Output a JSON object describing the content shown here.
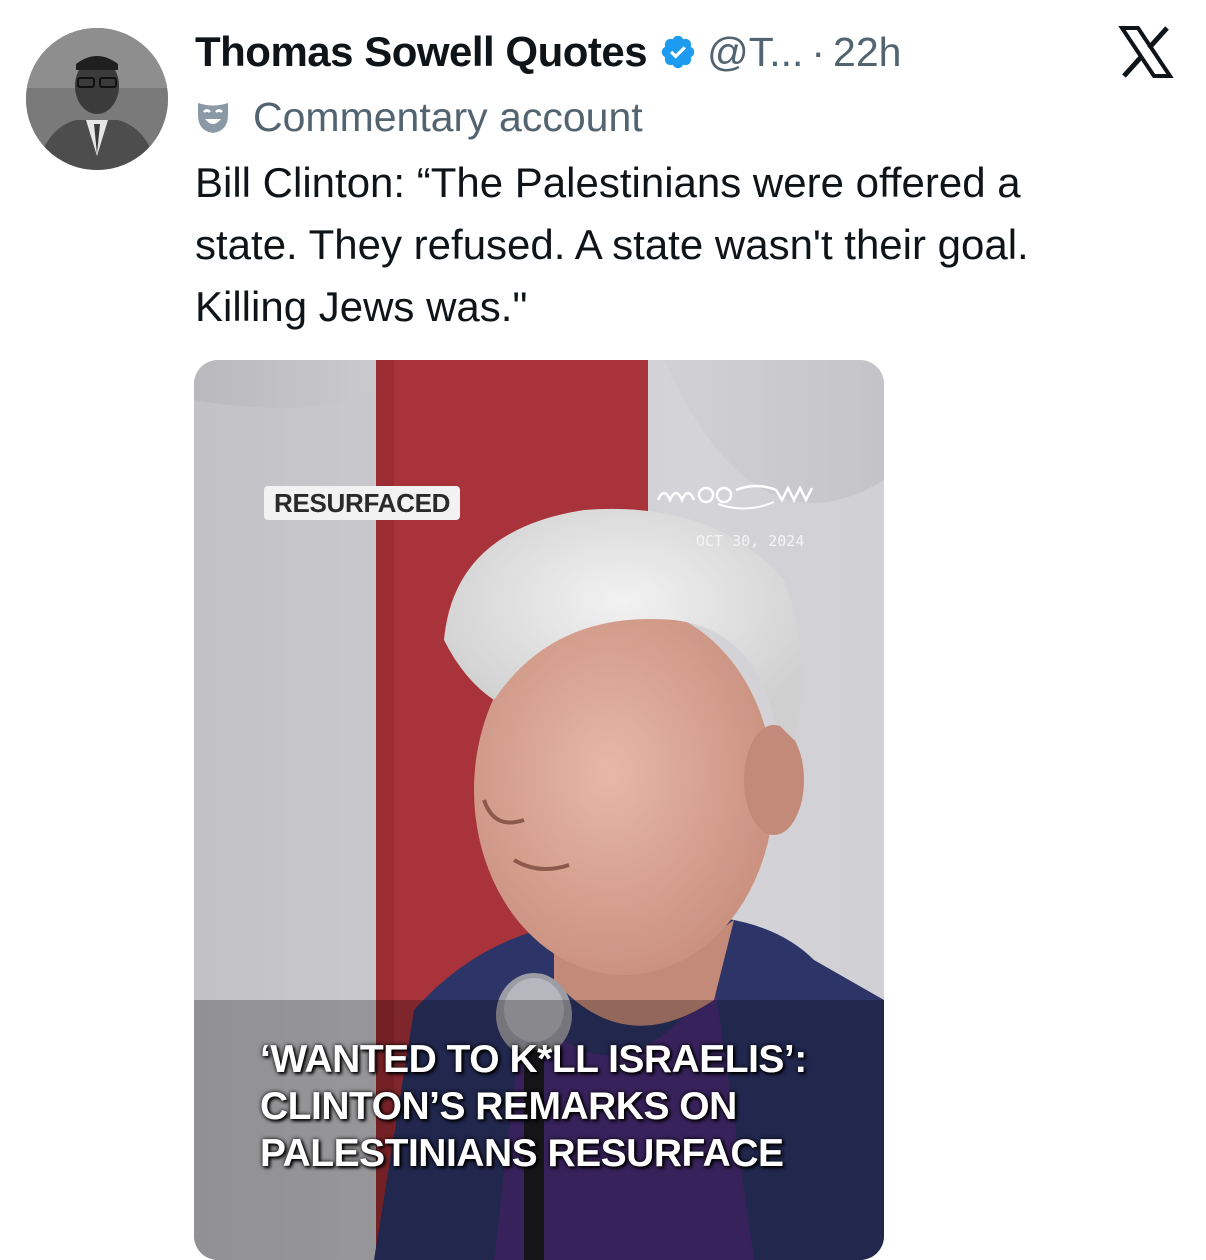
{
  "tweet": {
    "author": {
      "display_name": "Thomas Sowell Quotes",
      "handle": "@T...",
      "verified": true,
      "avatar_icon": "profile-photo"
    },
    "separator": "·",
    "timestamp": "22h",
    "label": "Commentary account",
    "text": "Bill Clinton: “The Palestinians were offered a\nstate. They refused. A state wasn't their goal.\nKilling Jews was.\"",
    "media": {
      "badge": "RESURFACED",
      "brand_logo_icon": "mea-wave-logo",
      "date": "OCT 30, 2024",
      "caption": "‘WANTED TO K*LL ISRAELIS’:\nCLINTON’S REMARKS ON\nPALESTINIANS RESURFACE"
    }
  },
  "colors": {
    "text_primary": "#0f1419",
    "text_secondary": "#536471",
    "verified_blue": "#1d9bf0",
    "flag_red": "#a8333a"
  },
  "icons": [
    "verified-badge-icon",
    "x-logo-icon",
    "commentary-mask-icon"
  ]
}
